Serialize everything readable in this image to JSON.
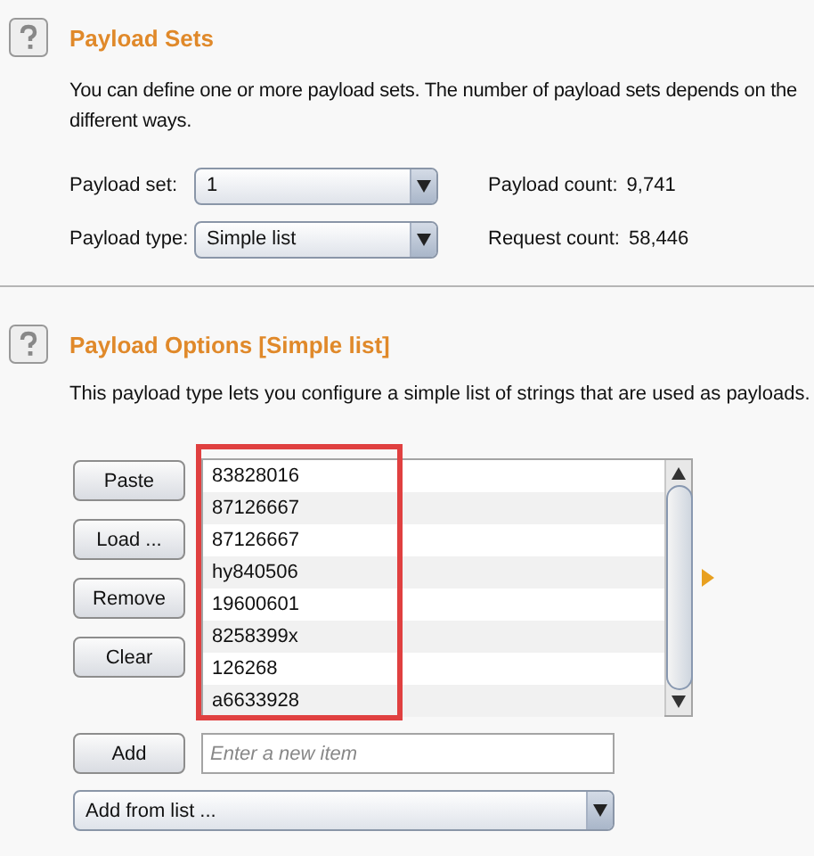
{
  "payload_sets": {
    "title": "Payload Sets",
    "description_lines": [
      "You can define one or more payload sets. The number of payload sets depends on the",
      "different ways."
    ],
    "fields": [
      {
        "label": "Payload set:",
        "value": "1",
        "info_label": "Payload count:",
        "info_value": "9,741"
      },
      {
        "label": "Payload type:",
        "value": "Simple list",
        "info_label": "Request count:",
        "info_value": "58,446"
      }
    ]
  },
  "payload_options": {
    "title": "Payload Options [Simple list]",
    "description": "This payload type lets you configure a simple list of strings that are used as payloads.",
    "buttons": [
      "Paste",
      "Load ...",
      "Remove",
      "Clear"
    ],
    "items": [
      "83828016",
      "87126667",
      "87126667",
      "hy840506",
      "19600601",
      "8258399x",
      "126268",
      "a6633928"
    ],
    "add_button": "Add",
    "new_item": {
      "placeholder": "Enter a new item"
    },
    "add_from_list": "Add from list ..."
  }
}
